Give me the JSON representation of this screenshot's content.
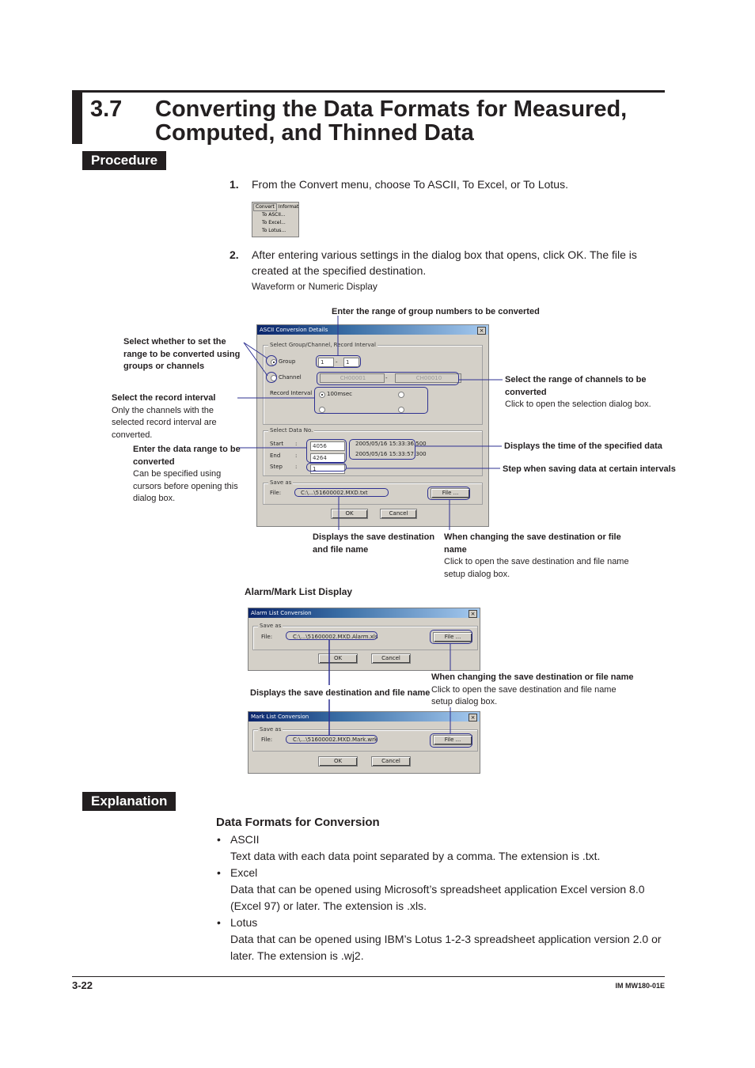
{
  "header": {
    "section_number": "3.7",
    "section_title": "Converting the Data Formats for Measured, Computed, and Thinned Data"
  },
  "procedure": {
    "label": "Procedure",
    "steps": [
      {
        "number": "1.",
        "text": "From the Convert menu, choose To ASCII, To Excel, or To Lotus."
      },
      {
        "number": "2.",
        "text": "After entering various settings in the dialog box that opens, click OK. The file is created at the specified destination."
      }
    ],
    "menu_screenshot": {
      "menu_bar": [
        "Convert",
        "Informat"
      ],
      "items": [
        "To ASCII...",
        "To Excel...",
        "To Lotus..."
      ]
    },
    "subheading_waveform": "Waveform or Numeric Display",
    "subheading_alarm": "Alarm/Mark List Display"
  },
  "ascii_dialog": {
    "title": "ASCII Conversion Details",
    "close": "×",
    "group1_label": "Select Group/Channel, Record Interval",
    "group_radio": "Group",
    "channel_radio": "Channel",
    "group_from": "1",
    "group_sep": "-",
    "group_to": "1",
    "channel_from": "CH00001",
    "channel_sep": "-",
    "channel_to": "CH00010",
    "record_interval_label": "Record Interval",
    "record_interval_option": "100msec",
    "group2_label": "Select Data No.",
    "start_label": "Start",
    "end_label": "End",
    "step_label": "Step",
    "colon": ":",
    "start_value": "4056",
    "end_value": "4264",
    "step_value": "1",
    "start_time": "2005/05/16 15:33:36.500",
    "end_time": "2005/05/16 15:33:57.300",
    "group3_label": "Save as",
    "file_label": "File:",
    "file_value": "C:\\...\\51600002.MXD.txt",
    "file_button": "File ...",
    "ok": "OK",
    "cancel": "Cancel"
  },
  "ascii_annotations": {
    "group_range": "Enter the range of group numbers to be converted",
    "group_or_channel": "Select whether to set the range to be converted using groups or channels",
    "record_interval_title": "Select the record interval",
    "record_interval_desc": "Only the channels with the selected record interval are converted.",
    "data_range_title": "Enter the data range to be converted",
    "data_range_desc": "Can be specified using cursors before opening this dialog box.",
    "channel_range_title": "Select the range of channels to be converted",
    "channel_range_desc": "Click to open the selection dialog box.",
    "time_display": "Displays the time of the specified data",
    "step_desc": "Step when saving data at certain intervals",
    "save_dest": "Displays the save destination and file name",
    "change_dest_title": "When changing the save destination or file name",
    "change_dest_desc": "Click to open the save destination and file name setup dialog box."
  },
  "alarm_dialog": {
    "title": "Alarm List Conversion",
    "close": "×",
    "group_label": "Save as",
    "file_label": "File:",
    "file_value": "C:\\...\\51600002.MXD.Alarm.xls",
    "file_button": "File ...",
    "ok": "OK",
    "cancel": "Cancel"
  },
  "mark_dialog": {
    "title": "Mark List Conversion",
    "close": "×",
    "group_label": "Save as",
    "file_label": "File:",
    "file_value": "C:\\...\\51600002.MXD.Mark.wrk",
    "file_button": "File ...",
    "ok": "OK",
    "cancel": "Cancel"
  },
  "list_annotations": {
    "save_dest": "Displays the save destination and file name",
    "change_dest_title": "When changing the save destination or file name",
    "change_dest_desc": "Click to open the save destination and file name setup dialog box."
  },
  "explanation": {
    "label": "Explanation",
    "heading": "Data Formats for Conversion",
    "bullet": "•",
    "items": [
      {
        "name": "ASCII",
        "desc": "Text data with each data point separated by a comma. The extension is .txt."
      },
      {
        "name": "Excel",
        "desc": "Data that can be opened using Microsoft’s spreadsheet application Excel version 8.0 (Excel 97) or later. The extension is .xls."
      },
      {
        "name": "Lotus",
        "desc": "Data that can be opened using IBM’s Lotus 1-2-3 spreadsheet application version 2.0 or later. The extension is .wj2."
      }
    ]
  },
  "footer": {
    "page_number": "3-22",
    "doc_id": "IM MW180-01E"
  },
  "colors": {
    "text": "#231f20",
    "leader": "#2e3192",
    "dialog_bg": "#d4d0c8",
    "title_bar_start": "#0a246a",
    "title_bar_end": "#a6caf0"
  }
}
